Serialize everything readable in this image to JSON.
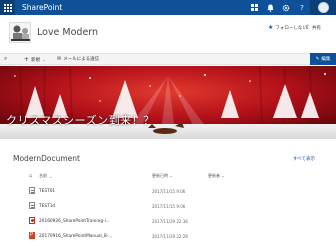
{
  "suite": {
    "brand": "SharePoint",
    "icons": [
      "app-grid-icon",
      "bell-icon",
      "gear-icon",
      "help-icon"
    ],
    "help_label": "?"
  },
  "header": {
    "site_title": "Love Modern",
    "follow_label": "フォローしない",
    "share_label": "共有"
  },
  "cmdbar": {
    "new_label": "新規",
    "email_label": "メールによる送信",
    "edit_label": "編集"
  },
  "hero": {
    "text": "クリスマスシーズン到来！？"
  },
  "documents": {
    "title": "ModernDocument",
    "show_all": "すべて表示",
    "columns": [
      "名前",
      "更新日時",
      "更新者"
    ],
    "rows": [
      {
        "icon": "text-file-icon",
        "name": "TEST01",
        "modified": "2017/11/15 9:06"
      },
      {
        "icon": "text-file-icon",
        "name": "TEST1d",
        "modified": "2017/11/15 9:06"
      },
      {
        "icon": "pdf-file-icon",
        "name": "20160926_SharePointTraining-i...",
        "modified": "2017/11/29 22:38"
      },
      {
        "icon": "powerpoint-file-icon",
        "name": "20170916_SharePointManual_B-...",
        "modified": "2017/11/29 22:28"
      }
    ]
  },
  "colors": {
    "suite_bar": "#0f5199",
    "accent": "#0f5199",
    "hero_red": "#c2141b"
  }
}
